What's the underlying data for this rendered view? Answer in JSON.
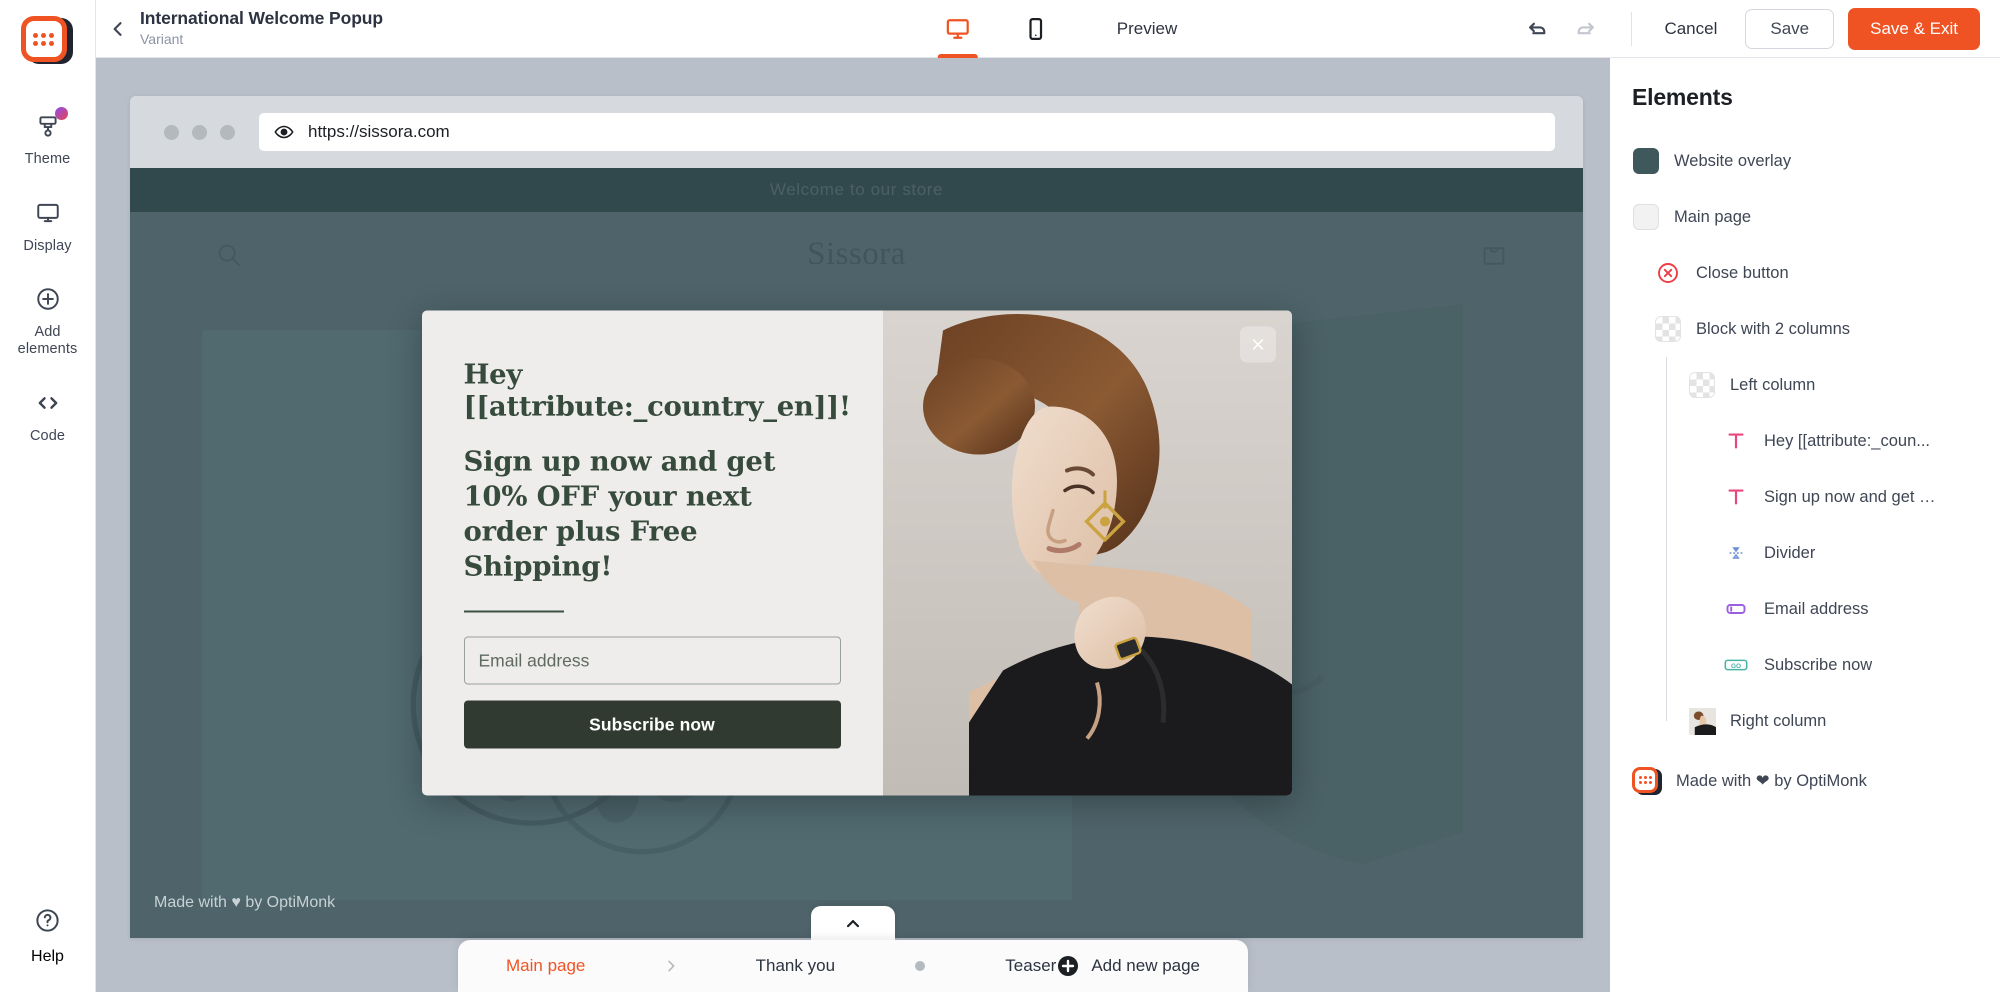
{
  "colors": {
    "brand_orange": "#f05323",
    "dark_text": "#2d3340",
    "muted_text": "#8b93a3",
    "overlay_swatch": "#3f585c",
    "popup_bg": "#efecec",
    "popup_heading": "#374b3c",
    "popup_button": "#303a30",
    "site_announce": "#31494d",
    "site_bg": "#4e646a"
  },
  "rail": {
    "logo_name": "optimonk-logo",
    "items": [
      {
        "label": "Theme",
        "icon": "paintbrush-icon",
        "badge": true
      },
      {
        "label": "Display",
        "icon": "monitor-icon",
        "badge": false
      },
      {
        "label": "Add\nelements",
        "label_line1": "Add",
        "label_line2": "elements",
        "icon": "plus-circle-icon",
        "badge": false
      },
      {
        "label": "Code",
        "icon": "code-brackets-icon",
        "badge": false
      }
    ],
    "help": {
      "label": "Help",
      "icon": "question-circle-icon"
    }
  },
  "topbar": {
    "back_icon": "chevron-left-icon",
    "title": "International Welcome Popup",
    "subtitle": "Variant",
    "devices": [
      {
        "name": "desktop",
        "icon": "monitor-icon",
        "active": true
      },
      {
        "name": "mobile",
        "icon": "phone-icon",
        "active": false
      }
    ],
    "preview_label": "Preview",
    "undo_icon": "undo-arrow-icon",
    "redo_icon": "redo-arrow-icon",
    "cancel_label": "Cancel",
    "save_label": "Save",
    "save_exit_label": "Save & Exit"
  },
  "browser": {
    "eye_icon": "eye-icon",
    "url": "https://sissora.com",
    "traffic_light_count": 3
  },
  "site": {
    "announcement": "Welcome to our store",
    "logo": "Sissora",
    "search_icon": "search-icon",
    "cart_icon": "shopping-bag-icon",
    "footer_note": "Made with ♥ by OptiMonk"
  },
  "popup": {
    "heading_line1": "Hey",
    "heading_line2": "[[attribute:_country_en]]!",
    "subheading": "Sign up now and get 10% OFF your next order plus Free Shipping!",
    "email_placeholder": "Email address",
    "submit_label": "Subscribe now",
    "close_icon": "close-x-icon"
  },
  "pagebar": {
    "collapse_icon": "chevron-up-icon",
    "pages": [
      {
        "label": "Main page",
        "active": true
      },
      {
        "label": "Thank you",
        "active": false
      },
      {
        "label": "Teaser",
        "active": false
      }
    ],
    "separator_icons": [
      "chevron-right-icon",
      "dot-icon"
    ],
    "add_icon": "plus-circle-filled-icon",
    "add_label": "Add new page"
  },
  "elements_panel": {
    "title": "Elements",
    "tree": [
      {
        "label": "Website overlay",
        "icon": "color-swatch-dark",
        "indent": 0
      },
      {
        "label": "Main page",
        "icon": "color-swatch-white",
        "indent": 0
      },
      {
        "label": "Close button",
        "icon": "close-circle-icon",
        "indent": 1
      },
      {
        "label": "Block with 2 columns",
        "icon": "transparent-swatch",
        "indent": 1
      },
      {
        "label": "Left column",
        "icon": "transparent-swatch",
        "indent": 2
      },
      {
        "label": "Hey [[attribute:_coun...",
        "icon": "text-t-icon",
        "indent": 3
      },
      {
        "label": "Sign up now and get …",
        "icon": "text-t-icon",
        "indent": 3
      },
      {
        "label": "Divider",
        "icon": "divider-icon",
        "indent": 3
      },
      {
        "label": "Email address",
        "icon": "input-field-icon",
        "indent": 3
      },
      {
        "label": "Subscribe now",
        "icon": "go-button-icon",
        "indent": 3
      },
      {
        "label": "Right column",
        "icon": "image-thumbnail-icon",
        "indent": 2
      }
    ],
    "footer_label": "Made with ❤ by OptiMonk",
    "footer_icon": "optimonk-logo"
  }
}
